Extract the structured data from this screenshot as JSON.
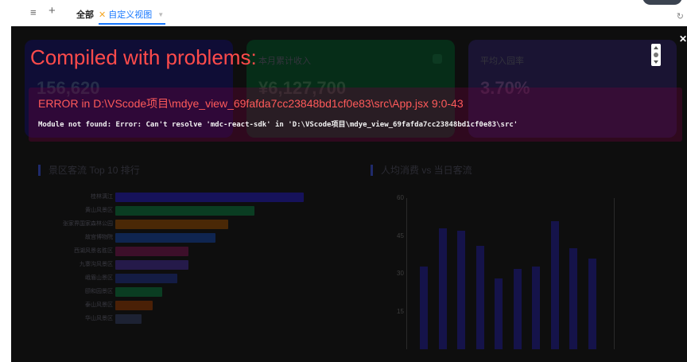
{
  "toolbar": {
    "menu_icon": "hamburger-icon",
    "add_icon": "plus-icon",
    "tab_all": "全部",
    "tab_custom": "自定义视图",
    "tab_custom_icon": "star-icon",
    "refresh_icon": "refresh-icon"
  },
  "cards": [
    {
      "label": "",
      "value": "156,620"
    },
    {
      "label": "本月累计收入",
      "value": "¥6,127,700"
    },
    {
      "label": "平均入园率",
      "value": "3.70%"
    }
  ],
  "ranking": {
    "title": "景区客流 Top 10 排行",
    "items": [
      {
        "label": "桂林漓江",
        "value": 100,
        "color": "#16125a"
      },
      {
        "label": "黄山风景区",
        "value": 74,
        "color": "#0a3d22"
      },
      {
        "label": "张家界国家森林公园",
        "value": 60,
        "color": "#4a2806"
      },
      {
        "label": "故宫博物院",
        "value": 53,
        "color": "#0f2550"
      },
      {
        "label": "西湖风景名胜区",
        "value": 39,
        "color": "#3d0f2a"
      },
      {
        "label": "九寨沟风景区",
        "value": 39,
        "color": "#251a4a"
      },
      {
        "label": "峨眉山景区",
        "value": 33,
        "color": "#141c44"
      },
      {
        "label": "颐和园景区",
        "value": 25,
        "color": "#0a3d22"
      },
      {
        "label": "泰山风景区",
        "value": 20,
        "color": "#4a2006"
      },
      {
        "label": "华山风景区",
        "value": 14,
        "color": "#1d2233"
      }
    ]
  },
  "scatter": {
    "title": "人均消费 vs 当日客流",
    "ticks": [
      "60",
      "45",
      "30",
      "15"
    ]
  },
  "chart_data": {
    "type": "bar",
    "title": "人均消费 vs 当日客流",
    "ylim": [
      0,
      60
    ],
    "values": [
      33,
      48,
      47,
      41,
      28,
      32,
      33,
      51,
      40,
      36
    ]
  },
  "overlay": {
    "title": "Compiled with problems:",
    "close_icon": "close-icon",
    "error": "ERROR in D:\\VScode项目\\mdye_view_69fafda7cc23848bd1cf0e83\\src\\App.jsx 9:0-43",
    "message": "Module not found: Error: Can't resolve 'mdc-react-sdk' in 'D:\\VScode项目\\mdye_view_69fafda7cc23848bd1cf0e83\\src'"
  }
}
